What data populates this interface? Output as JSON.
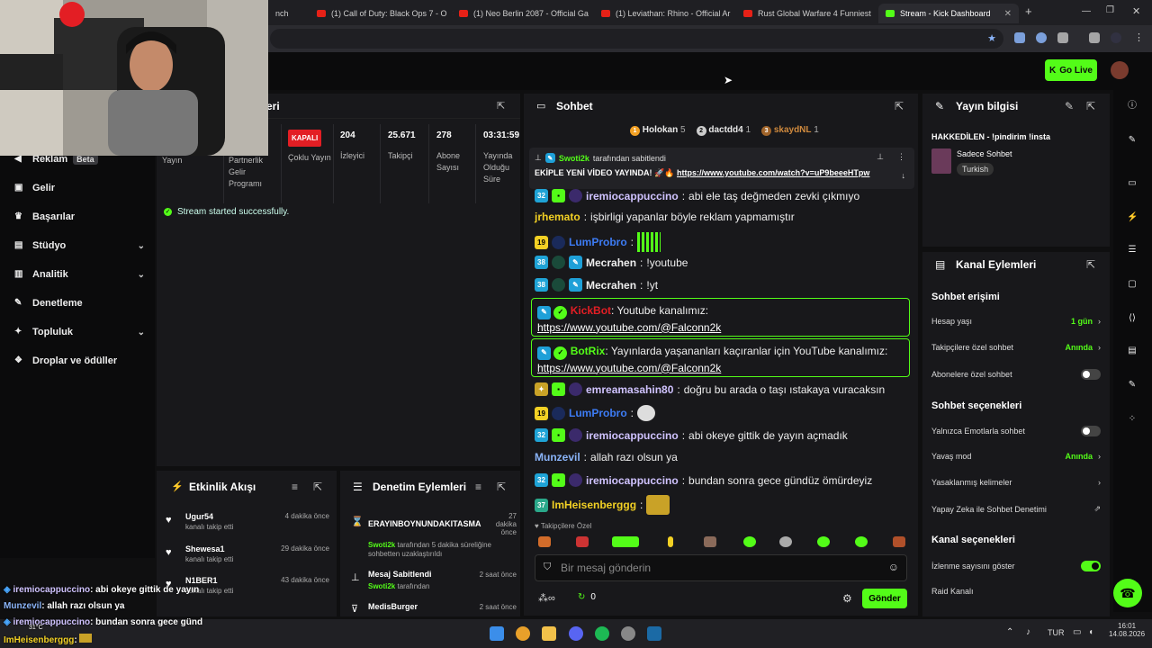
{
  "browser": {
    "tabs": [
      {
        "label": "nch"
      },
      {
        "label": "(1) Call of Duty: Black Ops 7 - O"
      },
      {
        "label": "(1) Neo Berlin 2087 - Official Ga"
      },
      {
        "label": "(1) Leviathan: Rhino - Official Ar"
      },
      {
        "label": "Rust Global Warfare 4 Funniest"
      },
      {
        "label": "Stream - Kick Dashboard"
      }
    ],
    "new_tab": "+"
  },
  "topbar": {
    "go_live": "Go Live"
  },
  "nav": {
    "items": [
      {
        "label": "Reklam",
        "badge": "Beta"
      },
      {
        "label": "Gelir"
      },
      {
        "label": "Başarılar"
      },
      {
        "label": "Stüdyo"
      },
      {
        "label": "Analitik"
      },
      {
        "label": "Denetleme"
      },
      {
        "label": "Topluluk"
      },
      {
        "label": "Droplar ve ödüller"
      }
    ]
  },
  "stats": {
    "title_partial": "eri",
    "cols": [
      {
        "value": "",
        "label": "Yayın"
      },
      {
        "value": "",
        "label": "Partnerlik Gelir Programı"
      },
      {
        "value": "KAPALI",
        "label": "Çoklu Yayın"
      },
      {
        "value": "204",
        "label": "İzleyici"
      },
      {
        "value": "25.671",
        "label": "Takipçi"
      },
      {
        "value": "278",
        "label": "Abone Sayısı"
      },
      {
        "value": "03:31:59",
        "label": "Yayında Olduğu Süre"
      }
    ],
    "status": "Stream started successfully."
  },
  "activity": {
    "title": "Etkinlik Akışı",
    "events": [
      {
        "name": "Ugur54",
        "desc": "kanalı takip etti",
        "time": "4 dakika önce"
      },
      {
        "name": "Shewesa1",
        "desc": "kanalı takip etti",
        "time": "29 dakika önce"
      },
      {
        "name": "N1BER1",
        "desc": "kanalı takip etti",
        "time": "43 dakika önce"
      }
    ]
  },
  "moderation": {
    "title": "Denetim Eylemleri",
    "actions": [
      {
        "name": "ERAYINBOYNUNDAKITASMA",
        "by": "Swoti2k",
        "desc": "tarafından 5 dakika süreliğine sohbetten uzaklaştırıldı",
        "time": "27 dakika önce"
      },
      {
        "name": "Mesaj Sabitlendi",
        "by": "Swoti2k",
        "desc": "tarafından",
        "time": "2 saat önce"
      },
      {
        "name": "MedisBurger",
        "by": "",
        "desc": "",
        "time": "2 saat önce"
      }
    ]
  },
  "chat": {
    "title": "Sohbet",
    "top": [
      {
        "rank": "1",
        "name": "Holokan",
        "count": "5"
      },
      {
        "rank": "2",
        "name": "dactdd4",
        "count": "1"
      },
      {
        "rank": "3",
        "name": "skaydNL",
        "count": "1"
      }
    ],
    "pinned": {
      "by": "Swoti2k",
      "by_suffix": "tarafından sabitlendi",
      "text": "EKİPLE YENİ VİDEO YAYINDA! 🚀🔥",
      "link": "https://www.youtube.com/watch?v=uP9beeeHTpw"
    },
    "messages": [
      {
        "badge": "32",
        "user": "iremiocappuccino",
        "color": "#d0c3ff",
        "text": "abi ele taş değmeden zevki çıkmıyo"
      },
      {
        "badge": "",
        "user": "jrhemato",
        "color": "#f2d024",
        "text": "işbirligi yapanlar böyle reklam yapmamıştır"
      },
      {
        "badge": "19",
        "user": "LumProbro",
        "color": "#3d7cf5",
        "text": ""
      },
      {
        "badge": "38",
        "user": "Mecrahen",
        "color": "#e8e8e8",
        "text": "!youtube"
      },
      {
        "badge": "38",
        "user": "Mecrahen",
        "color": "#e8e8e8",
        "text": "!yt"
      },
      {
        "badge": "",
        "user": "KickBot",
        "color": "#e31e24",
        "text": "Youtube kanalımız:",
        "link": "https://www.youtube.com/@Falconn2k"
      },
      {
        "badge": "",
        "user": "BotRix",
        "color": "#53fc18",
        "text": "Yayınlarda yaşananları kaçıranlar için YouTube kanalımız:",
        "link": "https://www.youtube.com/@Falconn2k"
      },
      {
        "badge": "",
        "user": "emreamasahin80",
        "color": "#d0c3ff",
        "text": "doğru bu arada o taşı ıstakaya vuracaksın"
      },
      {
        "badge": "19",
        "user": "LumProbro",
        "color": "#3d7cf5",
        "text": ""
      },
      {
        "badge": "32",
        "user": "iremiocappuccino",
        "color": "#d0c3ff",
        "text": "abi okeye gittik de yayın açmadık"
      },
      {
        "badge": "",
        "user": "Munzevil",
        "color": "#8ab4f8",
        "text": "allah razı olsun ya"
      },
      {
        "badge": "32",
        "user": "iremiocappuccino",
        "color": "#d0c3ff",
        "text": "bundan sonra gece gündüz ömürdeyiz"
      },
      {
        "badge": "37",
        "user": "ImHeisenberggg",
        "color": "#f2d024",
        "text": ""
      }
    ],
    "followers_only": "Takipçilere Özel",
    "input_placeholder": "Bir mesaj gönderin",
    "points": "0",
    "send": "Gönder"
  },
  "info": {
    "title": "Yayın bilgisi",
    "stream_title": "HAKKEDİLEN - !pindirim !insta",
    "category": "Sadece Sohbet",
    "language": "Turkish"
  },
  "channel": {
    "title": "Kanal Eylemleri",
    "sec_access": "Sohbet erişimi",
    "account_age": "Hesap yaşı",
    "account_age_val": "1 gün",
    "followers_chat": "Takipçilere özel sohbet",
    "followers_chat_val": "Anında",
    "subs_chat": "Abonelere özel sohbet",
    "sec_options": "Sohbet seçenekleri",
    "emote_only": "Yalnızca Emotlarla sohbet",
    "slow_mode": "Yavaş mod",
    "slow_mode_val": "Anında",
    "banned_words": "Yasaklanmış kelimeler",
    "ai_mod": "Yapay Zeka ile Sohbet Denetimi",
    "sec_channel": "Kanal seçenekleri",
    "show_viewers": "İzlenme sayısını göster",
    "raid": "Raid Kanalı"
  },
  "overlay": [
    {
      "user": "iremiocappuccino",
      "text": ": abi okeye gittik de yayın"
    },
    {
      "user": "Munzevil",
      "text": ": allah razı olsun ya"
    },
    {
      "user": "iremiocappuccino",
      "text": ": bundan sonra gece günd"
    },
    {
      "user": "ImHeisenberggg",
      "text": ":"
    }
  ],
  "taskbar": {
    "lang": "TUR",
    "time": "16:01",
    "date": "14.08.2026",
    "weather": "31°C"
  }
}
